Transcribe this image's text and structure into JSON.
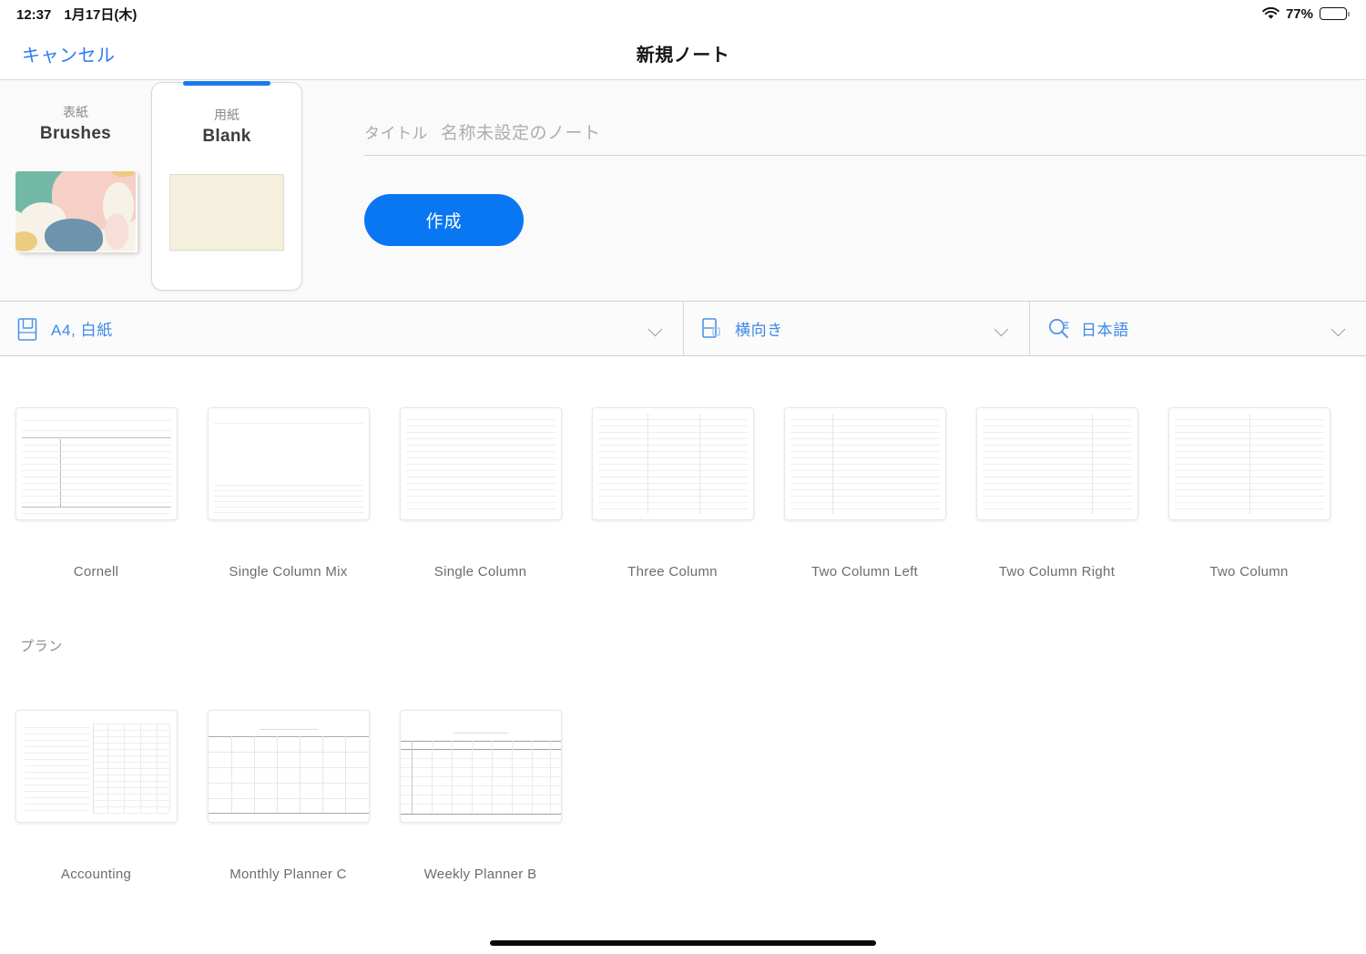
{
  "status_bar": {
    "time": "12:37",
    "date": "1月17日(木)",
    "wifi_icon": "wifi-icon",
    "battery_percent": "77%",
    "battery_level": 77,
    "battery_icon": "battery-icon"
  },
  "navbar": {
    "cancel_label": "キャンセル",
    "title": "新規ノート"
  },
  "config": {
    "cover_picker": {
      "kind_label": "表紙",
      "name": "Brushes",
      "selected": false,
      "thumbnail": "cover-brushes-thumbnail"
    },
    "paper_picker": {
      "kind_label": "用紙",
      "name": "Blank",
      "selected": true,
      "thumbnail": "paper-blank-thumbnail"
    },
    "title_field": {
      "label": "タイトル",
      "value": "",
      "placeholder": "名称未設定のノート"
    },
    "create_button": {
      "label": "作成"
    }
  },
  "selectors": [
    {
      "name": "paper-size-select",
      "icon": "page-size-icon",
      "value": "A4, 白紙",
      "chevron": "chevron-down-icon"
    },
    {
      "name": "orientation-select",
      "icon": "orientation-icon",
      "value": "横向き",
      "chevron": "chevron-down-icon"
    },
    {
      "name": "language-select",
      "icon": "ocr-search-icon",
      "value": "日本語",
      "chevron": "chevron-down-icon"
    }
  ],
  "templates": {
    "note_section": {
      "heading": "",
      "items": [
        {
          "label": "Cornell",
          "style": "cornell"
        },
        {
          "label": "Single Column Mix",
          "style": "single-column-mix"
        },
        {
          "label": "Single Column",
          "style": "single-column"
        },
        {
          "label": "Three Column",
          "style": "three-column"
        },
        {
          "label": "Two Column Left",
          "style": "two-column-left"
        },
        {
          "label": "Two Column Right",
          "style": "two-column-right"
        },
        {
          "label": "Two Column",
          "style": "two-column"
        }
      ]
    },
    "plan_section": {
      "heading": "プラン",
      "items": [
        {
          "label": "Accounting",
          "style": "accounting"
        },
        {
          "label": "Monthly Planner C",
          "style": "monthly-planner"
        },
        {
          "label": "Weekly Planner B",
          "style": "weekly-planner"
        }
      ]
    }
  },
  "colors": {
    "accent_blue": "#0a77f2",
    "link_blue": "#2b7cf0",
    "select_blue": "#3d88e8",
    "panel_bg": "#fafafa",
    "paper_cream": "#f5f0de",
    "cover_teal": "#73b8a4",
    "cover_pink": "#f6cfc7",
    "cover_blue": "#6d93ad",
    "cover_yellow": "#edcb80",
    "cover_cream": "#f7f2e8"
  },
  "home_indicator": "home-indicator"
}
